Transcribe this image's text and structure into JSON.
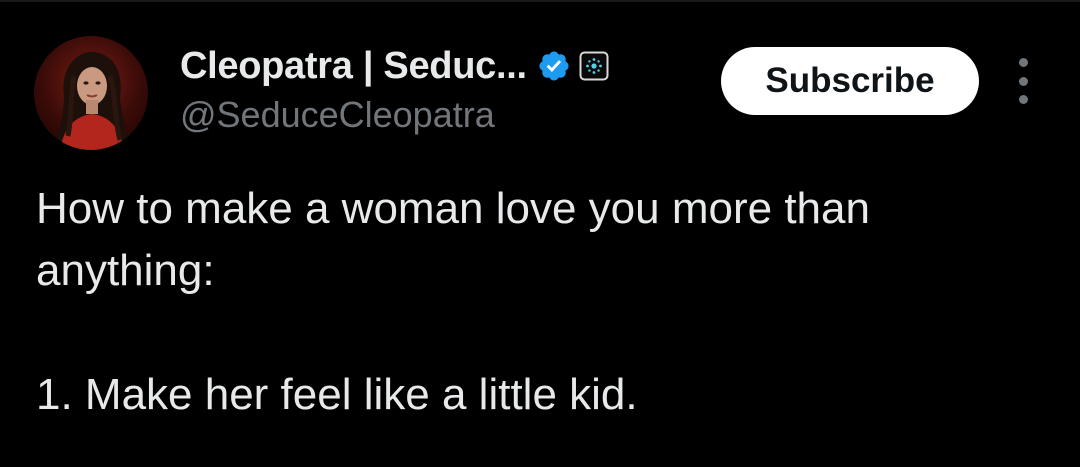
{
  "author": {
    "display_name": "Cleopatra | Seduc...",
    "handle": "@SeduceCleopatra",
    "verified_icon": "verified-badge-icon",
    "affiliate_icon": "affiliate-badge-icon"
  },
  "actions": {
    "subscribe_label": "Subscribe",
    "more_icon": "more-vertical-icon"
  },
  "tweet": {
    "lines": [
      "How to make a woman love you more than",
      "anything:",
      "",
      "1. Make her feel like a little kid."
    ]
  },
  "colors": {
    "background": "#000000",
    "text_primary": "#e7e9ea",
    "text_secondary": "#71767b",
    "verified_blue": "#1d9bf0",
    "button_bg": "#ffffff",
    "button_text": "#0f1419"
  }
}
